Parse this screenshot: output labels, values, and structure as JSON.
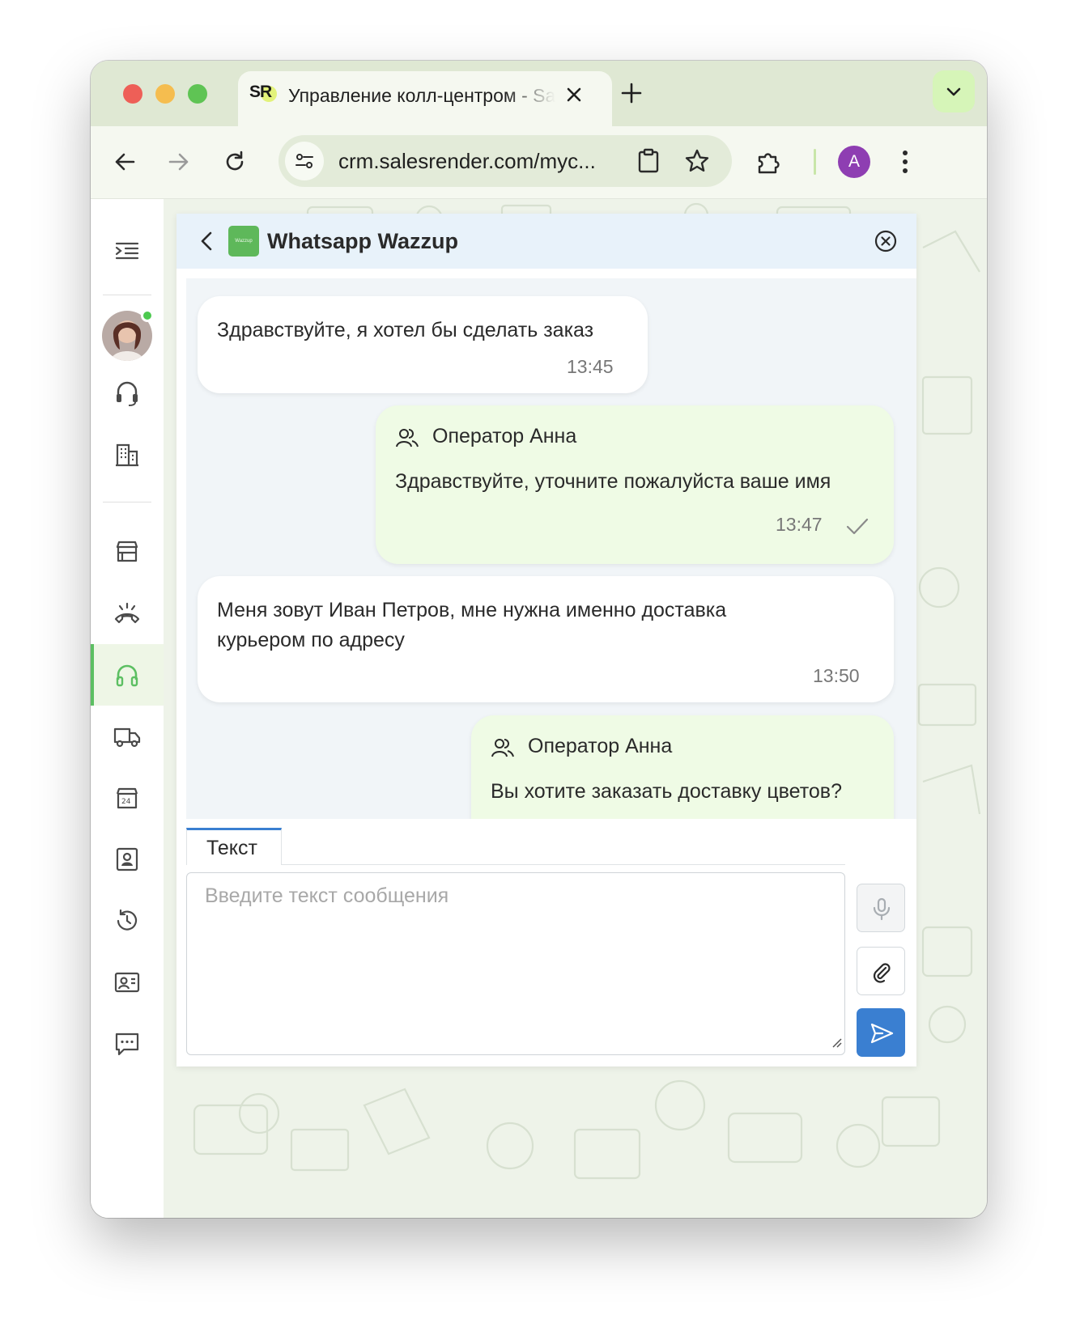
{
  "browser": {
    "tab": {
      "favicon_text": "SR",
      "title": "Управление колл-центром - SalesRender"
    },
    "url": "crm.salesrender.com/myc...",
    "profile_initial": "A",
    "accent_color": "#dfe8d3"
  },
  "sidebar": {
    "items": [
      {
        "icon": "menu-indent-icon"
      },
      {
        "icon": "headset-icon"
      },
      {
        "icon": "building-icon"
      },
      {
        "icon": "store-icon"
      },
      {
        "icon": "phone-ringing-icon"
      },
      {
        "icon": "headphones-icon",
        "active": true
      },
      {
        "icon": "delivery-truck-icon"
      },
      {
        "icon": "store-24-icon"
      },
      {
        "icon": "contact-card-icon"
      },
      {
        "icon": "history-icon"
      },
      {
        "icon": "id-card-icon"
      },
      {
        "icon": "chat-icon"
      }
    ],
    "active_color": "#5cbf62"
  },
  "chat": {
    "title": "Whatsapp Wazzup",
    "logo_text": "Wazzup",
    "messages": [
      {
        "direction": "in",
        "text": "Здравствуйте, я хотел бы сделать заказ",
        "time": "13:45"
      },
      {
        "direction": "out",
        "operator": "Оператор Анна",
        "text": "Здравствуйте, уточните пожалуйста ваше имя",
        "time": "13:47"
      },
      {
        "direction": "in",
        "text_line1": "Меня зовут Иван Петров, мне нужна именно доставка",
        "text_line2": "курьером по адресу",
        "time": "13:50"
      },
      {
        "direction": "out",
        "operator": "Оператор Анна",
        "text": "Вы хотите заказать доставку цветов?"
      }
    ]
  },
  "composer": {
    "tab_label": "Текст",
    "placeholder": "Введите текст сообщения",
    "send_color": "#3a7fd1"
  }
}
